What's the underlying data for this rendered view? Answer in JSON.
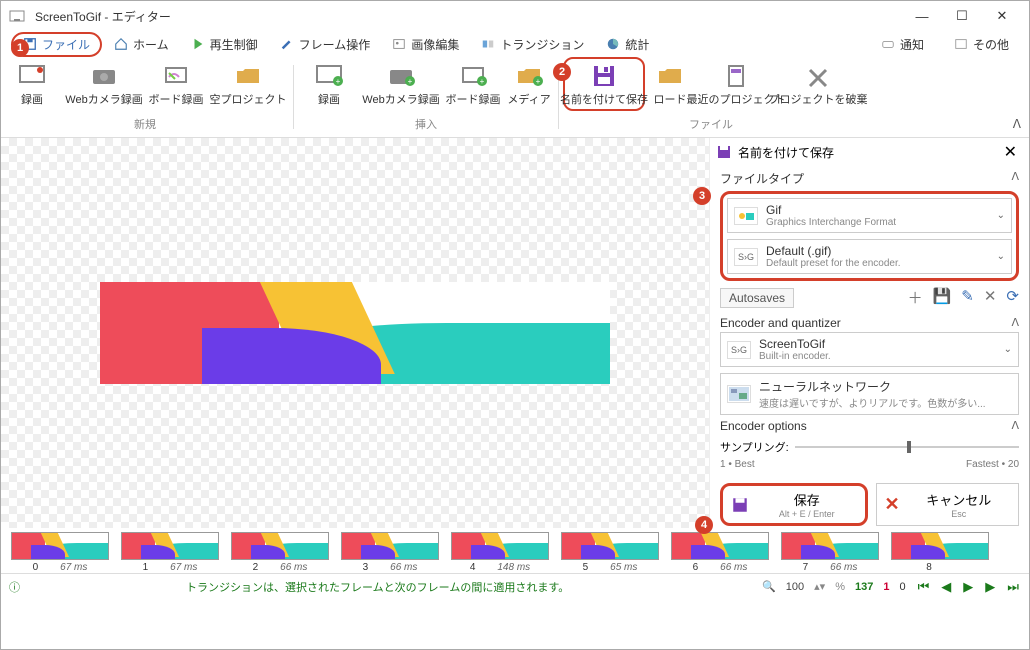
{
  "window": {
    "title": "ScreenToGif - エディター"
  },
  "win_btns": {
    "min": "—",
    "max": "☐",
    "close": "✕"
  },
  "tabs": {
    "file": "ファイル",
    "home": "ホーム",
    "playback": "再生制御",
    "frame": "フレーム操作",
    "image": "画像編集",
    "transition": "トランジション",
    "stats": "統計"
  },
  "top_right": {
    "notify": "通知",
    "other": "その他"
  },
  "ribbon": {
    "group_new": "新規",
    "group_insert": "挿入",
    "group_file": "ファイル",
    "items_new": [
      {
        "key": "rec",
        "label": "録画"
      },
      {
        "key": "webcam",
        "label": "Webカメラ録画"
      },
      {
        "key": "board",
        "label": "ボード録画"
      },
      {
        "key": "blank",
        "label": "空プロジェクト"
      }
    ],
    "items_insert": [
      {
        "key": "rec2",
        "label": "録画"
      },
      {
        "key": "webcam2",
        "label": "Webカメラ録画"
      },
      {
        "key": "board2",
        "label": "ボード録画"
      },
      {
        "key": "media",
        "label": "メディア"
      }
    ],
    "items_file": [
      {
        "key": "saveas",
        "label": "名前を付けて保存"
      },
      {
        "key": "load",
        "label": "ロード"
      },
      {
        "key": "recent",
        "label": "最近のプロジェクト"
      },
      {
        "key": "discard",
        "label": "プロジェクトを破棄"
      }
    ]
  },
  "side": {
    "title": "名前を付けて保存",
    "section_filetype": "ファイルタイプ",
    "gif": {
      "name": "Gif",
      "desc": "Graphics Interchange Format"
    },
    "preset": {
      "name": "Default (.gif)",
      "desc": "Default preset for the encoder."
    },
    "autosaves": "Autosaves",
    "section_encoder": "Encoder and quantizer",
    "enc": {
      "name": "ScreenToGif",
      "desc": "Built-in encoder."
    },
    "quant": {
      "name": "ニューラルネットワーク",
      "desc": "速度は遅いですが、よりリアルです。色数が多い..."
    },
    "section_opts": "Encoder options",
    "sampling_label": "サンプリング:",
    "best_label": "1 • Best",
    "fast_label": "Fastest • 20",
    "save_label": "保存",
    "save_hint": "Alt + E / Enter",
    "cancel_label": "キャンセル",
    "cancel_hint": "Esc"
  },
  "thumbs": [
    {
      "idx": "0",
      "ms": "67 ms"
    },
    {
      "idx": "1",
      "ms": "67 ms"
    },
    {
      "idx": "2",
      "ms": "66 ms"
    },
    {
      "idx": "3",
      "ms": "66 ms"
    },
    {
      "idx": "4",
      "ms": "148 ms"
    },
    {
      "idx": "5",
      "ms": "65 ms"
    },
    {
      "idx": "6",
      "ms": "66 ms"
    },
    {
      "idx": "7",
      "ms": "66 ms"
    },
    {
      "idx": "8",
      "ms": ""
    }
  ],
  "status": {
    "message": "トランジションは、選択されたフレームと次のフレームの間に適用されます。",
    "zoom": "100",
    "frames_total": "137",
    "frames_sel": "1",
    "frames_other": "0"
  },
  "callouts": {
    "c1": "1",
    "c2": "2",
    "c3": "3",
    "c4": "4"
  }
}
